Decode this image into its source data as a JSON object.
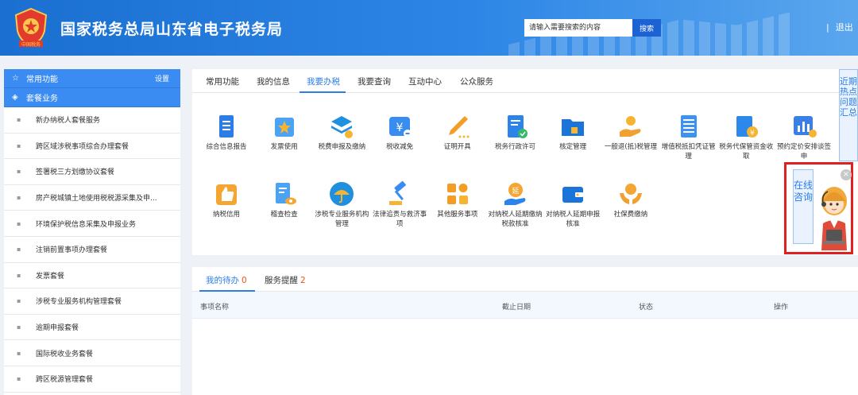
{
  "header": {
    "logo_text": "中国税务",
    "title": "国家税务总局山东省电子税务局",
    "search_placeholder": "请输入需要搜索的内容",
    "search_button": "搜索",
    "separator": "|",
    "logout": "退出"
  },
  "sidebar": {
    "common_functions": "常用功能",
    "settings": "设置",
    "package_services": "套餐业务",
    "items": [
      "新办纳税人套餐服务",
      "跨区域涉税事项综合办理套餐",
      "签署税三方划缴协议套餐",
      "房产税城镇土地使用税税源采集及申...",
      "环境保护税信息采集及申报业务",
      "注销前置事项办理套餐",
      "发票套餐",
      "涉税专业服务机构管理套餐",
      "逾期申报套餐",
      "国际税收业务套餐",
      "跨区税源管理套餐"
    ]
  },
  "main": {
    "tabs": [
      "常用功能",
      "我的信息",
      "我要办税",
      "我要查询",
      "互动中心",
      "公众服务"
    ],
    "active_tab": "我要办税",
    "tiles_row1": [
      {
        "label": "综合信息报告",
        "icon": "document-icon"
      },
      {
        "label": "发票使用",
        "icon": "invoice-star-icon"
      },
      {
        "label": "税费申报及缴纳",
        "icon": "layers-icon"
      },
      {
        "label": "税收减免",
        "icon": "yen-reduce-icon"
      },
      {
        "label": "证明开具",
        "icon": "pen-icon"
      },
      {
        "label": "税务行政许可",
        "icon": "license-check-icon"
      },
      {
        "label": "核定管理",
        "icon": "folder-stamp-icon"
      },
      {
        "label": "一般退(抵)税管理",
        "icon": "hand-coin-icon"
      },
      {
        "label": "增值税抵扣凭证管理",
        "icon": "ledger-icon"
      },
      {
        "label": "税务代保管资金收取",
        "icon": "yen-document-icon"
      },
      {
        "label": "预约定价安排谈签申",
        "icon": "chart-icon"
      }
    ],
    "tiles_row2": [
      {
        "label": "纳税信用",
        "icon": "thumbs-up-icon"
      },
      {
        "label": "稽查检查",
        "icon": "inspect-eye-icon"
      },
      {
        "label": "涉税专业服务机构管理",
        "icon": "umbrella-icon"
      },
      {
        "label": "法律追责与救济事项",
        "icon": "gavel-icon"
      },
      {
        "label": "其他服务事项",
        "icon": "grid-icon"
      },
      {
        "label": "对纳税人延期缴纳税款核准",
        "icon": "defer-coin-icon"
      },
      {
        "label": "对纳税人延期申报核准",
        "icon": "wallet-icon"
      },
      {
        "label": "社保费缴纳",
        "icon": "globe-hands-icon"
      }
    ]
  },
  "right_bar": {
    "label": "近期热点问题汇总"
  },
  "consult": {
    "label": "在线咨询",
    "close": "×"
  },
  "todo": {
    "tab_pending": "我的待办",
    "pending_count": "0",
    "tab_reminder": "服务提醒",
    "reminder_count": "2",
    "columns": [
      "事项名称",
      "截止日期",
      "状态",
      "操作"
    ]
  },
  "colors": {
    "brand": "#2b7de9",
    "header": "#1a6fd0",
    "highlight_border": "#e02020",
    "count_badge": "#e8541e"
  }
}
